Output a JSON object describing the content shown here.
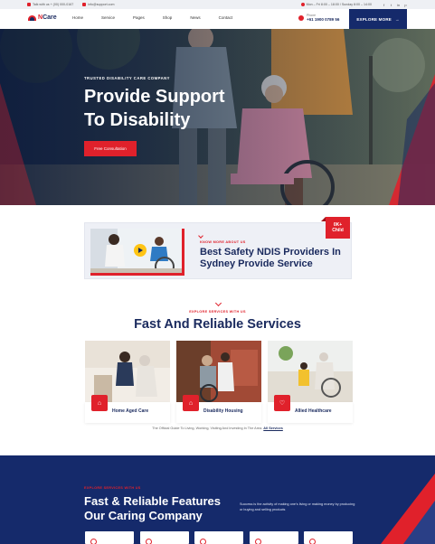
{
  "topbar": {
    "talk": "Talk with us + (00) 000-0167",
    "email": "info@support.com",
    "hours": "Mon – Fri 8:00 – 18:00 / Sunday 8:00 – 14:00",
    "social": [
      "f",
      "t",
      "in",
      "p"
    ]
  },
  "header": {
    "logo_n": "N",
    "logo_rest": "Care",
    "nav": [
      "Home",
      "Service",
      "Pages",
      "Shop",
      "News",
      "Contact"
    ],
    "phone_label": "Phone",
    "phone_number": "+61 1900 0789 56",
    "explore_label": "EXPLORE MORE"
  },
  "hero": {
    "tag": "TRUSTED DISABILITY CARE COMPANY",
    "title_line1": "Provide Support",
    "title_line2": "To Disability",
    "cta": "Free Consultation"
  },
  "about": {
    "kicker": "KNOW MORE ABOUT US",
    "title_line1": "Best Safety NDIS Providers In",
    "title_line2": "Sydney Provide Service",
    "badge_line1": "0K+",
    "badge_line2": "Child"
  },
  "services": {
    "kicker": "EXPLORE SERVICES WITH US",
    "title": "Fast And Reliable Services",
    "cards": [
      {
        "label": "Home Aged Care",
        "icon": "home-care-icon"
      },
      {
        "label": "Disability Housing",
        "icon": "house-icon"
      },
      {
        "label": "Allied Healthcare",
        "icon": "health-icon"
      }
    ],
    "note": "The Official Guide To Living, Working, Visiting And Investing In The Area.",
    "note_link": "All Services"
  },
  "features": {
    "kick": "EXPLORE SERVICES WITH US",
    "title_line1": "Fast & Reliable Features",
    "title_line2": "Our Caring Company",
    "text": "Success is the activity of making one's living or making money by producing or buying and selling products"
  },
  "colors": {
    "accent": "#e0212b",
    "navy": "#152a6b",
    "title": "#1a2a5e"
  }
}
